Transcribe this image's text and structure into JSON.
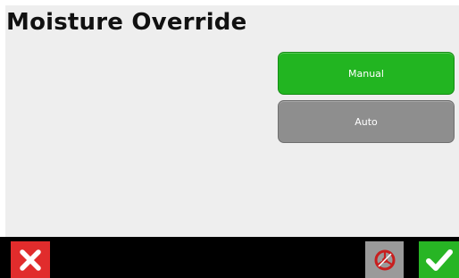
{
  "header": {
    "title": "Moisture Override"
  },
  "options": {
    "manual_label": "Manual",
    "auto_label": "Auto",
    "selected": "Manual"
  },
  "footer": {
    "cancel_icon": "close-icon",
    "nav_icon": "steering-wheel-icon",
    "confirm_icon": "checkmark-icon"
  },
  "colors": {
    "selected_green": "#22b521",
    "unselected_gray": "#8e8e8e",
    "cancel_red": "#e12c2c",
    "confirm_green": "#27b524"
  }
}
